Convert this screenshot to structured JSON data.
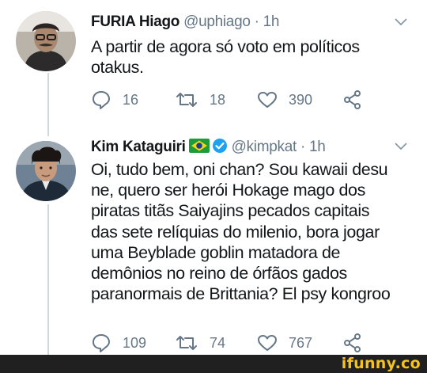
{
  "tweets": [
    {
      "name": "FURIA Hiago",
      "handle": "@uphiago",
      "separator": "·",
      "time": "1h",
      "lines": [
        "A partir de agora só voto em políticos",
        "otakus."
      ],
      "replies": "16",
      "retweets": "18",
      "likes": "390",
      "icons": [
        "avatar",
        "chevron-down-icon",
        "reply-icon",
        "retweet-icon",
        "like-icon",
        "share-icon"
      ]
    },
    {
      "name": "Kim Kataguiri",
      "handle": "@kimpkat",
      "separator": "·",
      "time": "1h",
      "badges": [
        "brazil-flag-icon",
        "verified-icon"
      ],
      "lines": [
        "Oi, tudo bem, oni chan? Sou kawaii desu",
        "ne, quero ser herói Hokage mago dos",
        "piratas titãs Saiyajins pecados capitais",
        "das sete relíquias do milenio, bora jogar",
        "uma Beyblade goblin matadora de",
        "demônios no reino de órfãos gados",
        "paranormais de Brittania? El psy kongroo"
      ],
      "replies": "109",
      "retweets": "74",
      "likes": "767",
      "icons": [
        "avatar",
        "chevron-down-icon",
        "reply-icon",
        "retweet-icon",
        "like-icon",
        "share-icon"
      ]
    }
  ],
  "watermark": "ifunny.co",
  "colors": {
    "text": "#14171a",
    "muted": "#657786",
    "thread_line": "#cfd9de",
    "verified": "#1da1f2",
    "watermark_bg": "#202020",
    "watermark_text": "#f6c21c"
  }
}
